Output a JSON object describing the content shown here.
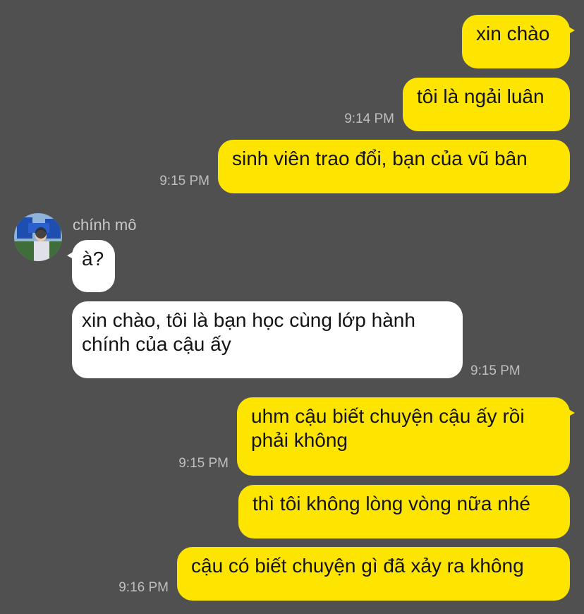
{
  "chat": {
    "messages": [
      {
        "direction": "out",
        "text": "xin chào"
      },
      {
        "direction": "out",
        "text": "tôi là ngải luân",
        "time": "9:14 PM"
      },
      {
        "direction": "out",
        "text": "sinh viên trao đổi, bạn của vũ bân",
        "time": "9:15 PM"
      },
      {
        "direction": "in",
        "sender": "chính mô",
        "text": "à?"
      },
      {
        "direction": "in",
        "lines": [
          "xin chào, tôi là bạn học cùng lớp hành",
          "chính của cậu ấy"
        ],
        "time": "9:15 PM"
      },
      {
        "direction": "out",
        "lines": [
          "uhm cậu biết chuyện cậu ấy rồi",
          "phải không"
        ],
        "time": "9:15 PM"
      },
      {
        "direction": "out",
        "text": "thì tôi không lòng vòng nữa nhé"
      },
      {
        "direction": "out",
        "text": "cậu có biết chuyện gì đã xảy ra không",
        "time": "9:16 PM"
      }
    ]
  },
  "colors": {
    "background": "#505050",
    "outgoing_bubble": "#FEE500",
    "incoming_bubble": "#FFFFFF",
    "timestamp": "#BEBEBE"
  },
  "icons": {
    "avatar": "profile-photo"
  }
}
